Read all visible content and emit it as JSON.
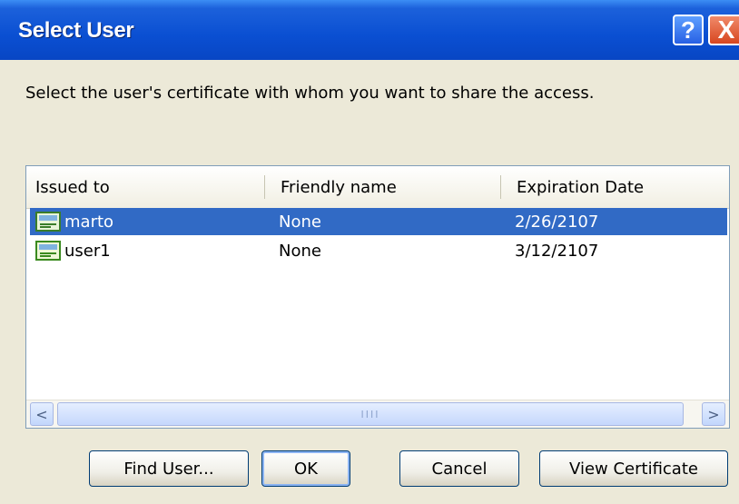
{
  "window": {
    "title": "Select User",
    "help_glyph": "?",
    "close_glyph": "X"
  },
  "instruction": "Select the user's certificate with whom you want to share the access.",
  "list": {
    "columns": [
      "Issued to",
      "Friendly name",
      "Expiration Date"
    ],
    "rows": [
      {
        "issued_to": "marto",
        "friendly_name": "None",
        "expiration": "2/26/2107",
        "selected": true,
        "icon": "certificate-icon"
      },
      {
        "issued_to": "user1",
        "friendly_name": "None",
        "expiration": "3/12/2107",
        "selected": false,
        "icon": "certificate-icon"
      }
    ],
    "scrollbar": {
      "left_arrow": "<",
      "right_arrow": ">",
      "grip": "IIII"
    }
  },
  "buttons": {
    "find_user": "Find User...",
    "ok": "OK",
    "cancel": "Cancel",
    "view_certificate": "View Certificate"
  },
  "colors": {
    "titlebar": "#0a4fd2",
    "selection": "#316ac5",
    "dialog_bg": "#ece9d8"
  }
}
